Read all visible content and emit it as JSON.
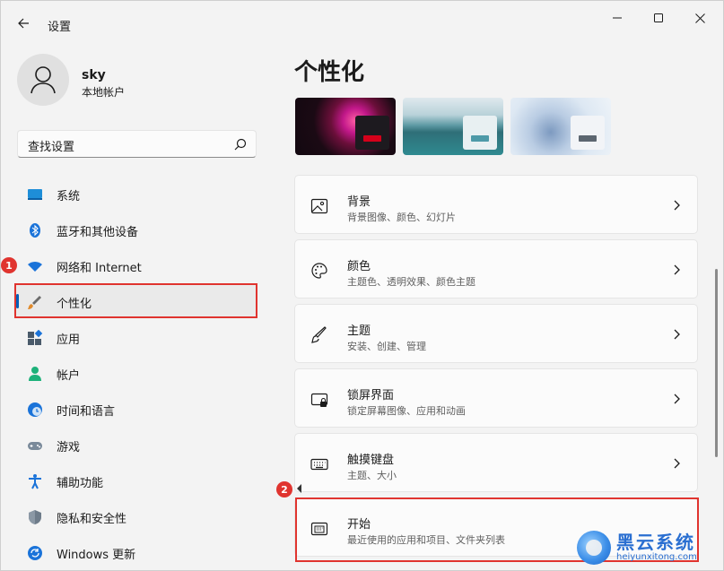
{
  "window": {
    "title": "设置"
  },
  "profile": {
    "name": "sky",
    "account_type": "本地帐户"
  },
  "search": {
    "placeholder": "查找设置"
  },
  "sidebar": {
    "items": [
      {
        "label": "系统",
        "icon": "system-monitor-icon"
      },
      {
        "label": "蓝牙和其他设备",
        "icon": "bluetooth-icon"
      },
      {
        "label": "网络和 Internet",
        "icon": "wifi-icon"
      },
      {
        "label": "个性化",
        "icon": "paintbrush-icon",
        "active": true
      },
      {
        "label": "应用",
        "icon": "apps-icon"
      },
      {
        "label": "帐户",
        "icon": "person-icon"
      },
      {
        "label": "时间和语言",
        "icon": "globe-clock-icon"
      },
      {
        "label": "游戏",
        "icon": "gamepad-icon"
      },
      {
        "label": "辅助功能",
        "icon": "accessibility-icon"
      },
      {
        "label": "隐私和安全性",
        "icon": "shield-icon"
      },
      {
        "label": "Windows 更新",
        "icon": "update-icon"
      }
    ]
  },
  "annotations": {
    "badge_1": "1",
    "badge_2": "2"
  },
  "main": {
    "title": "个性化",
    "cards": [
      {
        "title": "背景",
        "subtitle": "背景图像、颜色、幻灯片",
        "icon": "image-icon"
      },
      {
        "title": "颜色",
        "subtitle": "主题色、透明效果、颜色主题",
        "icon": "palette-icon"
      },
      {
        "title": "主题",
        "subtitle": "安装、创建、管理",
        "icon": "brush-icon"
      },
      {
        "title": "锁屏界面",
        "subtitle": "锁定屏幕图像、应用和动画",
        "icon": "lock-screen-icon"
      },
      {
        "title": "触摸键盘",
        "subtitle": "主题、大小",
        "icon": "keyboard-icon"
      },
      {
        "title": "开始",
        "subtitle": "最近使用的应用和项目、文件夹列表",
        "icon": "start-menu-icon"
      }
    ]
  },
  "watermark": {
    "name": "黑云系统",
    "url": "heiyunxitong.com"
  },
  "colors": {
    "accent": "#005fb8",
    "highlight": "#e0342f"
  }
}
